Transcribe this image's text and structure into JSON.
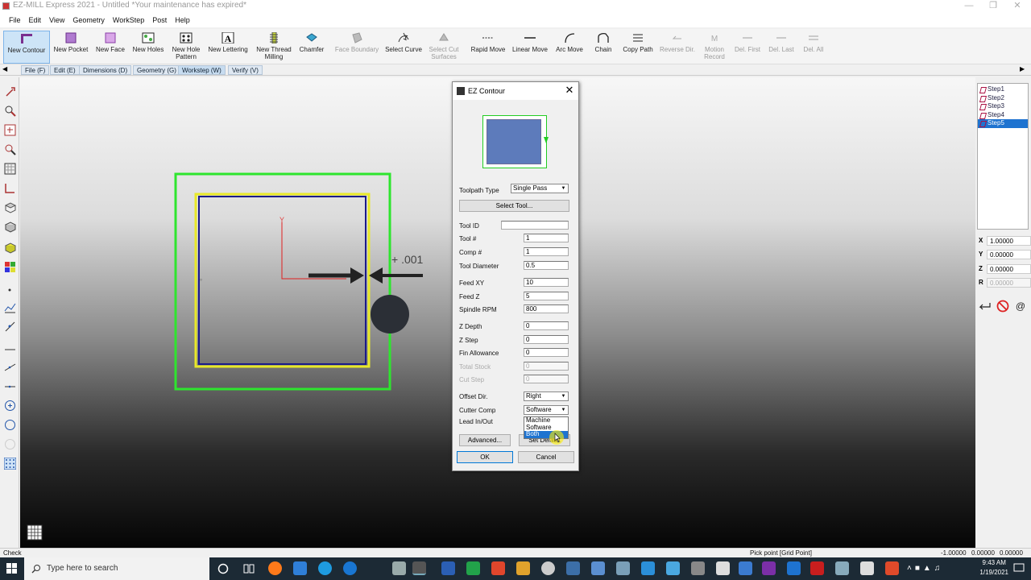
{
  "window": {
    "title": "EZ-MILL Express 2021 - Untitled  *Your maintenance has expired*"
  },
  "menu": [
    "File",
    "Edit",
    "View",
    "Geometry",
    "WorkStep",
    "Post",
    "Help"
  ],
  "toolbar": [
    {
      "label": "New Contour",
      "icon": "contour-icon",
      "state": "selected"
    },
    {
      "label": "New Pocket",
      "icon": "pocket-icon",
      "state": "enabled"
    },
    {
      "label": "New Face",
      "icon": "face-icon",
      "state": "enabled"
    },
    {
      "label": "New Holes",
      "icon": "holes-icon",
      "state": "enabled"
    },
    {
      "label": "New Hole Pattern",
      "icon": "hole-pattern-icon",
      "state": "enabled"
    },
    {
      "label": "New Lettering",
      "icon": "lettering-icon",
      "state": "enabled"
    },
    {
      "label": "New Thread Milling",
      "icon": "thread-milling-icon",
      "state": "enabled"
    },
    {
      "label": "Chamfer",
      "icon": "chamfer-icon",
      "state": "enabled"
    },
    {
      "label": "Face Boundary",
      "icon": "face-boundary-icon",
      "state": "disabled"
    },
    {
      "label": "Select Curve",
      "icon": "select-curve-icon",
      "state": "enabled"
    },
    {
      "label": "Select Cut Surfaces",
      "icon": "select-surfaces-icon",
      "state": "disabled"
    },
    {
      "label": "Rapid Move",
      "icon": "rapid-move-icon",
      "state": "enabled"
    },
    {
      "label": "Linear Move",
      "icon": "linear-move-icon",
      "state": "enabled"
    },
    {
      "label": "Arc Move",
      "icon": "arc-move-icon",
      "state": "enabled"
    },
    {
      "label": "Chain",
      "icon": "chain-icon",
      "state": "enabled"
    },
    {
      "label": "Copy Path",
      "icon": "copy-path-icon",
      "state": "enabled"
    },
    {
      "label": "Reverse Dir.",
      "icon": "reverse-dir-icon",
      "state": "disabled"
    },
    {
      "label": "Motion Record",
      "icon": "motion-record-icon",
      "state": "disabled"
    },
    {
      "label": "Del. First",
      "icon": "del-first-icon",
      "state": "disabled"
    },
    {
      "label": "Del. Last",
      "icon": "del-last-icon",
      "state": "disabled"
    },
    {
      "label": "Del. All",
      "icon": "del-all-icon",
      "state": "disabled"
    }
  ],
  "tabs": [
    "File (F)",
    "Edit (E)",
    "Dimensions (D)",
    "Geometry (G)",
    "Workstep (W)",
    "Verify (V)"
  ],
  "active_tab": "Workstep (W)",
  "viewport": {
    "annotation": "+ .001",
    "axis_label": "Y"
  },
  "steps": [
    "Step1",
    "Step2",
    "Step3",
    "Step4",
    "Step5"
  ],
  "selected_step": "Step5",
  "coords": [
    {
      "label": "X",
      "value": "1.00000"
    },
    {
      "label": "Y",
      "value": "0.00000"
    },
    {
      "label": "Z",
      "value": "0.00000"
    },
    {
      "label": "R",
      "value": "0.00000"
    }
  ],
  "status": {
    "left": "Check",
    "center": "Pick point [Grid Point]",
    "x": "-1.00000",
    "y": "0.00000",
    "z": "0.00000"
  },
  "taskbar": {
    "search_placeholder": "Type here to search",
    "time": "9:43 AM",
    "date": "1/19/2021"
  },
  "dialog": {
    "title": "EZ Contour",
    "toolpath_type_label": "Toolpath Type",
    "toolpath_type_value": "Single Pass",
    "select_tool_label": "Select Tool...",
    "fields": [
      {
        "label": "Tool ID",
        "value": "",
        "disabled": false
      },
      {
        "label": "Tool #",
        "value": "1",
        "disabled": false
      },
      {
        "label": "Comp #",
        "value": "1",
        "disabled": false
      },
      {
        "label": "Tool Diameter",
        "value": "0.5",
        "disabled": false
      },
      {
        "label": "Feed XY",
        "value": "10",
        "disabled": false
      },
      {
        "label": "Feed Z",
        "value": "5",
        "disabled": false
      },
      {
        "label": "Spindle RPM",
        "value": "800",
        "disabled": false
      },
      {
        "label": "Z Depth",
        "value": "0",
        "disabled": false
      },
      {
        "label": "Z Step",
        "value": "0",
        "disabled": false
      },
      {
        "label": "Fin Allowance",
        "value": "0",
        "disabled": false
      },
      {
        "label": "Total Stock",
        "value": "0",
        "disabled": true
      },
      {
        "label": "Cut Step",
        "value": "0",
        "disabled": true
      }
    ],
    "offset_dir_label": "Offset Dir.",
    "offset_dir_value": "Right",
    "cutter_comp_label": "Cutter Comp",
    "cutter_comp_value": "Software",
    "cutter_comp_options": [
      "Machine",
      "Software",
      "Both"
    ],
    "cutter_comp_highlighted": "Both",
    "lead_label": "Lead In/Out",
    "advanced_label": "Advanced...",
    "set_default_label": "Set Default",
    "ok_label": "OK",
    "cancel_label": "Cancel"
  }
}
